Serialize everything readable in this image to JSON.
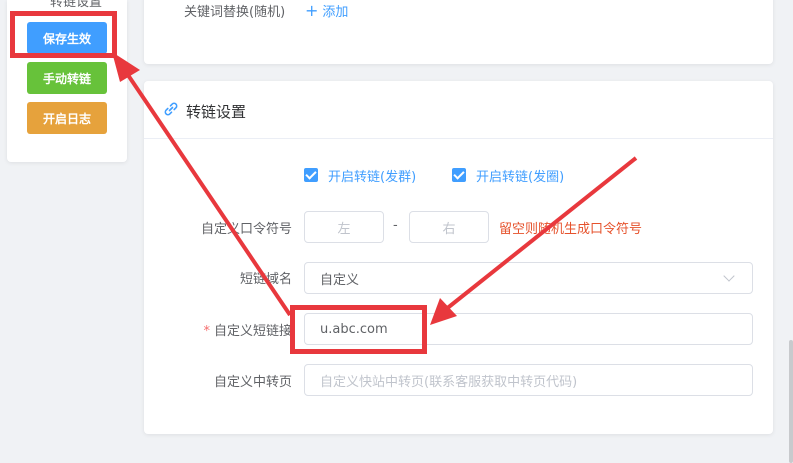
{
  "sidebar": {
    "title": "转链设置",
    "buttons": {
      "save": "保存生效",
      "manual": "手动转链",
      "log": "开启日志"
    }
  },
  "keyword_card": {
    "label": "关键词替换(随机)",
    "add_label": "添加"
  },
  "settings_card": {
    "title": "转链设置",
    "checkbox_group": {
      "group": "开启转链(发群)",
      "moments": "开启转链(发圈)"
    },
    "form": {
      "token_label": "自定义口令符号",
      "left_placeholder": "左",
      "dash": "-",
      "right_placeholder": "右",
      "token_hint": "留空则随机生成口令符号",
      "domain_label": "短链域名",
      "domain_value": "自定义",
      "short_link_label": "自定义短链接",
      "short_link_required": "*",
      "short_link_value": "u.abc.com",
      "middle_page_label": "自定义中转页",
      "middle_page_placeholder": "自定义快站中转页(联系客服获取中转页代码)"
    }
  },
  "colors": {
    "primary": "#409eff",
    "success": "#67c23a",
    "warning": "#e6a23c",
    "annotation": "#e8383d",
    "hint": "#e6522c"
  },
  "icons": {
    "card_title": "link-icon",
    "add": "plus-icon",
    "select": "chevron-down-icon"
  }
}
